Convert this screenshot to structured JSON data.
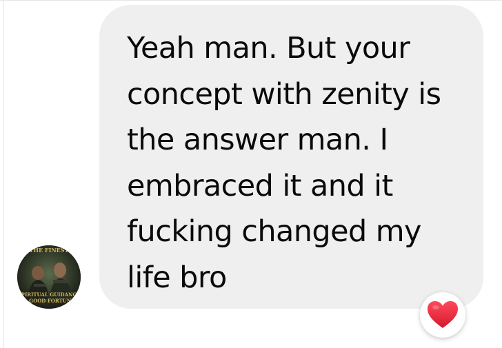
{
  "message": {
    "text": "Yeah man. But your concept with zenity is the answer man. I embraced it and it fucking changed my life bro",
    "reaction_icon": "heart-icon",
    "reaction_color": "#e4243a"
  },
  "avatar": {
    "caption_top": "THE FINEST",
    "caption_bottom_1": "SPIRITUAL GUIDANCE",
    "caption_bottom_2": "& GOOD FORTUNE"
  },
  "colors": {
    "bubble": "#efefef",
    "text": "#0a0a0a",
    "avatar_caption": "#d6b65a"
  }
}
